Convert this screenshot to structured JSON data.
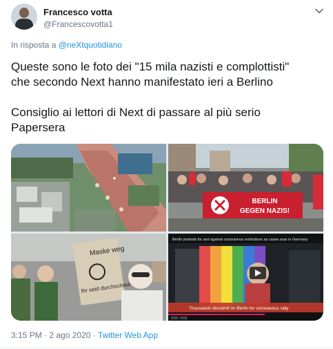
{
  "tweet": {
    "author_name": "Francesco votta",
    "author_handle": "@Francescovotta1",
    "reply_prefix": "In risposta a",
    "reply_to": "@neXtquotidiano",
    "line1": "Queste sono le foto dei \"15 mila nazisti e complottisti\"",
    "line2": "che secondo Next hanno manifestato ieri a Berlino",
    "line3": "Consiglio ai lettori di Next di passare al più serio",
    "line4": "Papersera",
    "timestamp": "3:15 PM · 2 ago 2020",
    "separator": " · ",
    "source": "Twitter Web App"
  },
  "media": {
    "banner_text_1": "BERLIN",
    "banner_text_2": "GEGEN NAZIS!",
    "sign_line_1": "Maske weg",
    "sign_line_2": "Ihr seid durchschaut",
    "video_caption_top": "Berlin protests for and against coronavirus restrictions as cases soar in Germany",
    "video_caption_bottom": "Thousands descend on Berlin for coronavirus rally",
    "video_time": "2:01 / 3:01"
  },
  "colors": {
    "accent": "#1b95e0",
    "secondary_text": "#657786"
  }
}
